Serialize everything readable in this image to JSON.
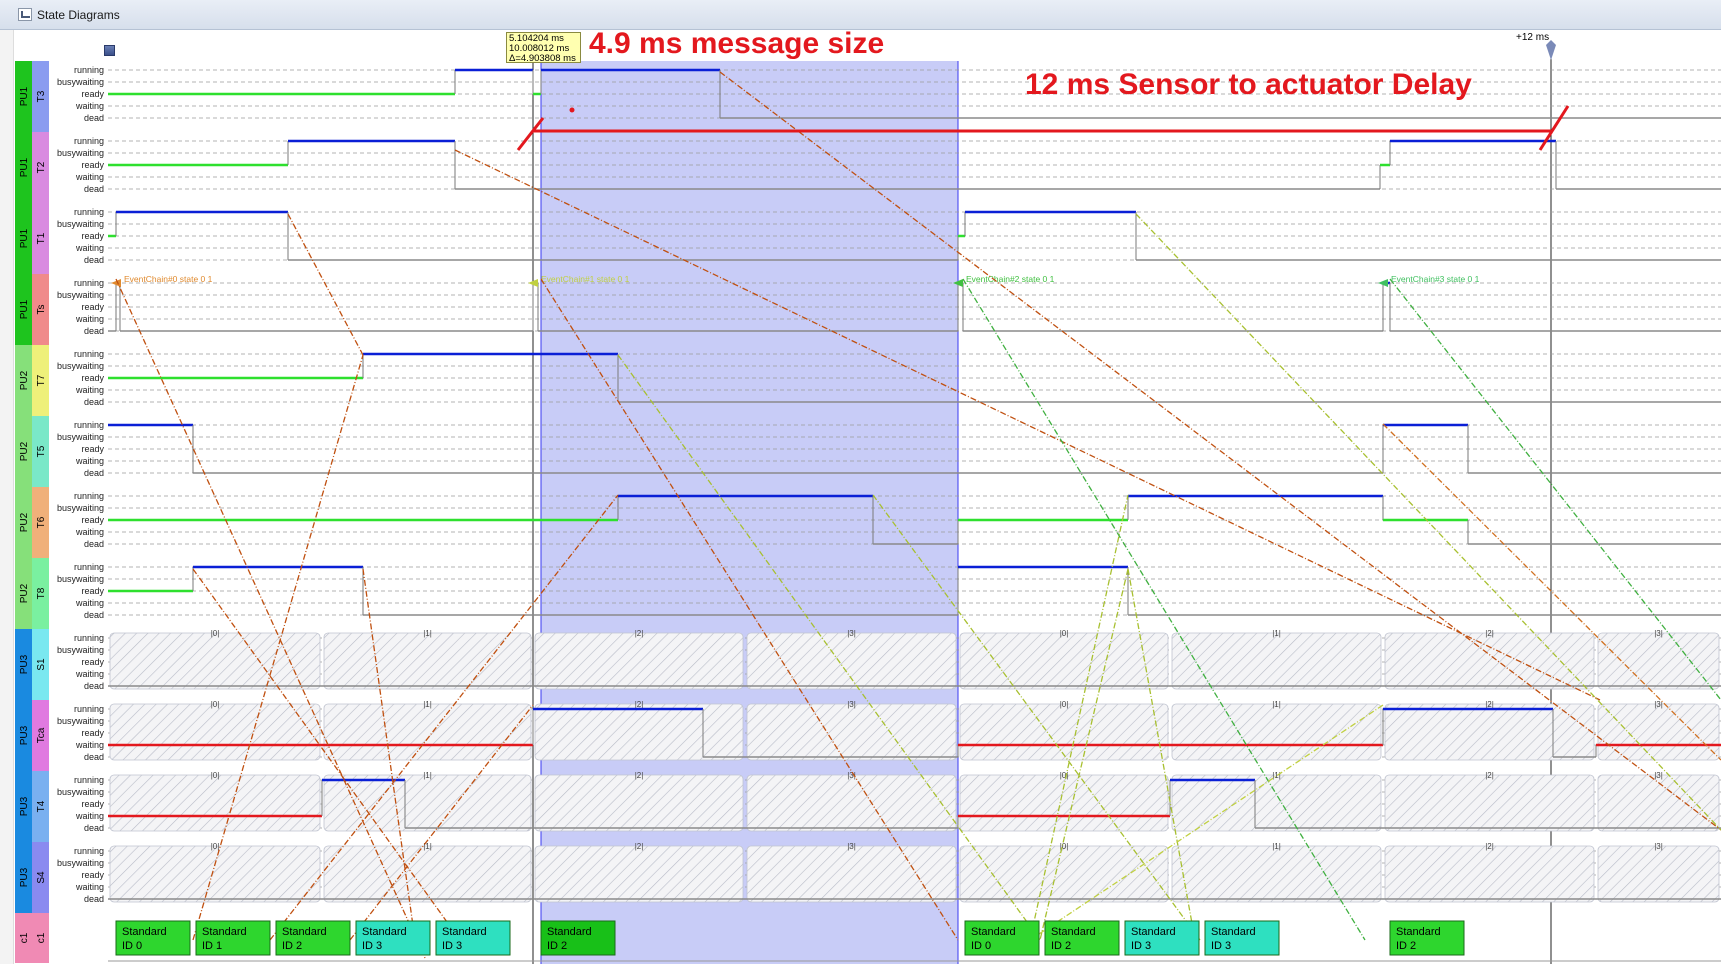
{
  "window": {
    "title": "State Diagrams"
  },
  "cursor_readout": {
    "line1": "5.104204 ms",
    "line2": "10.008012 ms",
    "line3": "Δ=4.903808 ms"
  },
  "time_marker": "+12 ms",
  "annotations": {
    "message_size": "4.9 ms message size",
    "delay": "12 ms Sensor to actuator Delay"
  },
  "states": [
    "running",
    "busywaiting",
    "ready",
    "waiting",
    "dead"
  ],
  "rows": [
    {
      "pu": "PU1",
      "task": "T3",
      "pu_color": "#1ec41e",
      "task_color": "#8a9cf0"
    },
    {
      "pu": "PU1",
      "task": "T2",
      "pu_color": "#1ec41e",
      "task_color": "#d98ae0"
    },
    {
      "pu": "PU1",
      "task": "T1",
      "pu_color": "#1ec41e",
      "task_color": "#d98ae0"
    },
    {
      "pu": "PU1",
      "task": "Ts",
      "pu_color": "#1ec41e",
      "task_color": "#f08a8a"
    },
    {
      "pu": "PU2",
      "task": "T7",
      "pu_color": "#86e07a",
      "task_color": "#eef07a"
    },
    {
      "pu": "PU2",
      "task": "T5",
      "pu_color": "#86e07a",
      "task_color": "#7ae8c8"
    },
    {
      "pu": "PU2",
      "task": "T6",
      "pu_color": "#86e07a",
      "task_color": "#f0b07a"
    },
    {
      "pu": "PU2",
      "task": "T8",
      "pu_color": "#86e07a",
      "task_color": "#7af0a0"
    },
    {
      "pu": "PU3",
      "task": "S1",
      "pu_color": "#1a8ae0",
      "task_color": "#7ae8f0"
    },
    {
      "pu": "PU3",
      "task": "Tca",
      "pu_color": "#1a8ae0",
      "task_color": "#e07ae0"
    },
    {
      "pu": "PU3",
      "task": "T4",
      "pu_color": "#1a8ae0",
      "task_color": "#7ab0f0"
    },
    {
      "pu": "PU3",
      "task": "S4",
      "pu_color": "#1a8ae0",
      "task_color": "#8a8af0"
    }
  ],
  "bus_row": {
    "pu": "c1",
    "task": "c1",
    "pu_color": "#f08ab4",
    "task_color": "#f08ab4"
  },
  "event_labels": [
    "EventChain#0 state 0 1",
    "EventChain#1 state 0 1",
    "EventChain#2 state 0 1",
    "EventChain#3 state 0 1"
  ],
  "period_labels": [
    "|0|",
    "|1|",
    "|2|",
    "|3|",
    "|0|",
    "|1|",
    "|2|",
    "|3|"
  ],
  "messages": [
    {
      "type": "Standard",
      "id": "ID 0",
      "color": "#2ed62e"
    },
    {
      "type": "Standard",
      "id": "ID 1",
      "color": "#2ed62e"
    },
    {
      "type": "Standard",
      "id": "ID 2",
      "color": "#2ed62e"
    },
    {
      "type": "Standard",
      "id": "ID 3",
      "color": "#2ee0c0"
    },
    {
      "type": "Standard",
      "id": "ID 3",
      "color": "#2ee0c0"
    },
    {
      "type": "Standard",
      "id": "ID 2",
      "color": "#18c018"
    },
    {
      "type": "Standard",
      "id": "ID 0",
      "color": "#2ed62e"
    },
    {
      "type": "Standard",
      "id": "ID 2",
      "color": "#2ed62e"
    },
    {
      "type": "Standard",
      "id": "ID 3",
      "color": "#2ee0c0"
    },
    {
      "type": "Standard",
      "id": "ID 3",
      "color": "#2ee0c0"
    },
    {
      "type": "Standard",
      "id": "ID 2",
      "color": "#2ed62e"
    }
  ],
  "colors": {
    "running": "#0a1fd6",
    "ready": "#2ee02e",
    "waiting": "#e3181e",
    "dead": "#8a8a8a",
    "selection": "#9aa2f0",
    "annotation": "#e3181e"
  }
}
